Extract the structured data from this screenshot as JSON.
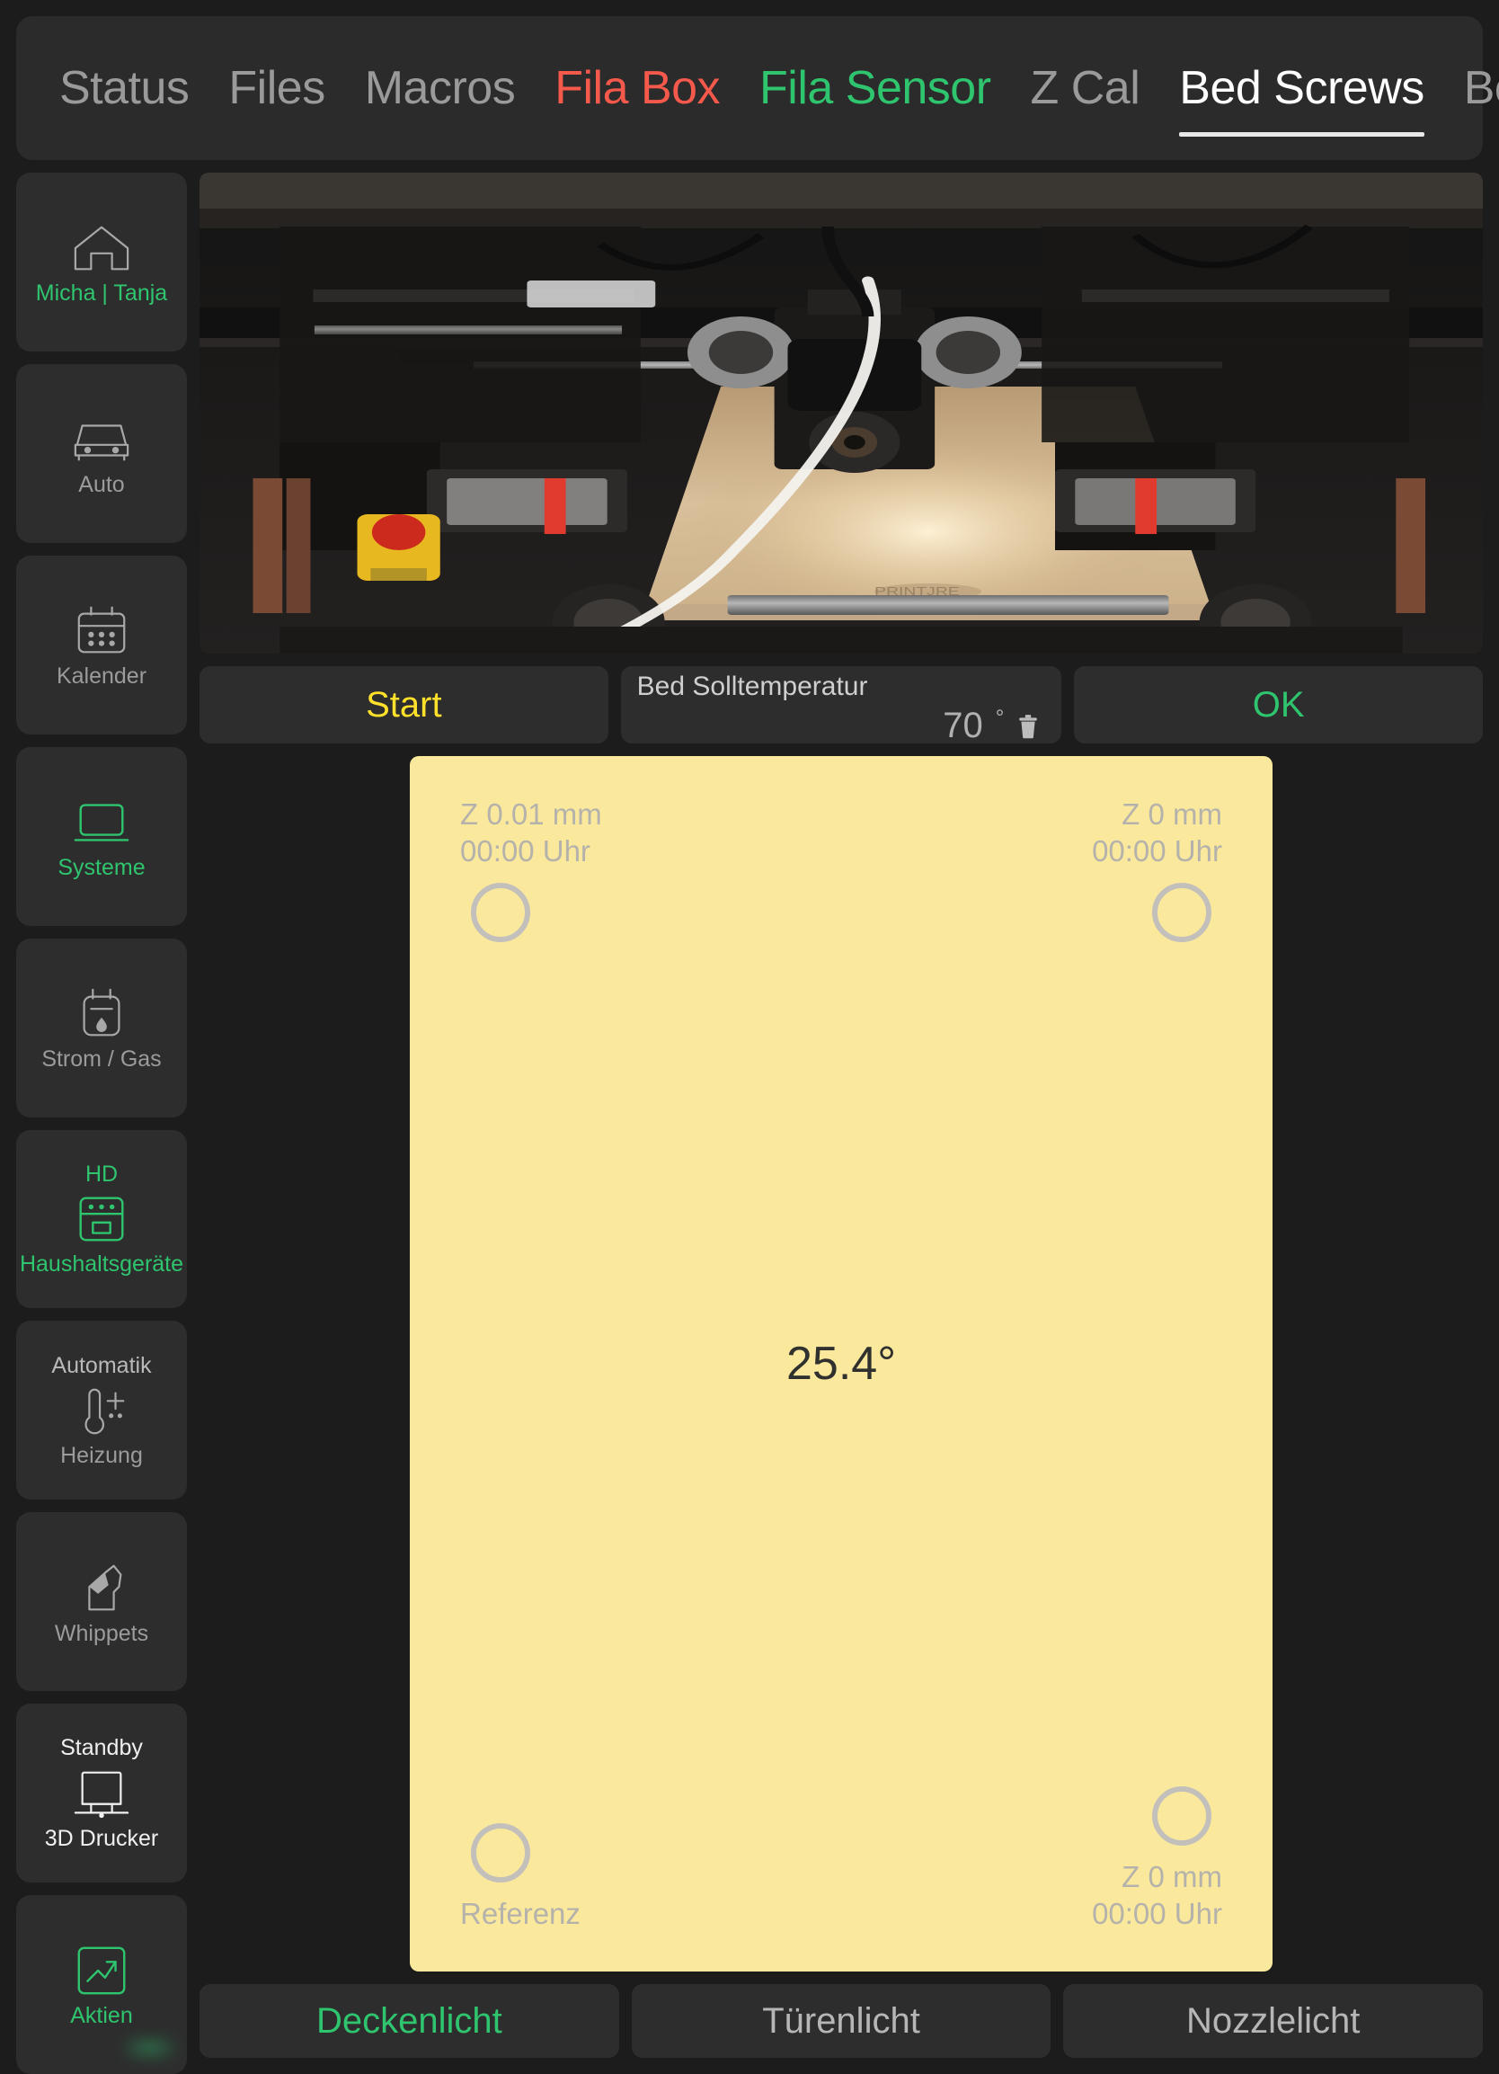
{
  "tabs": [
    {
      "label": "Status",
      "state": "normal"
    },
    {
      "label": "Files",
      "state": "normal"
    },
    {
      "label": "Macros",
      "state": "normal"
    },
    {
      "label": "Fila Box",
      "state": "red"
    },
    {
      "label": "Fila Sensor",
      "state": "green"
    },
    {
      "label": "Z Cal",
      "state": "normal"
    },
    {
      "label": "Bed Screws",
      "state": "active"
    },
    {
      "label": "Bed Mesh",
      "state": "normal"
    }
  ],
  "sidebar": {
    "items": [
      {
        "top": "",
        "label": "Micha | Tanja",
        "icon": "home-icon",
        "state": "green"
      },
      {
        "top": "",
        "label": "Auto",
        "icon": "car-icon",
        "state": "normal"
      },
      {
        "top": "",
        "label": "Kalender",
        "icon": "calendar-icon",
        "state": "normal"
      },
      {
        "top": "",
        "label": "Systeme",
        "icon": "laptop-icon",
        "state": "green"
      },
      {
        "top": "",
        "label": "Strom / Gas",
        "icon": "meter-icon",
        "state": "normal"
      },
      {
        "top": "HD",
        "label": "Haushaltsgeräte",
        "icon": "oven-icon",
        "state": "green"
      },
      {
        "top": "Automatik",
        "label": "Heizung",
        "icon": "thermostat-icon",
        "state": "normal"
      },
      {
        "top": "",
        "label": "Whippets",
        "icon": "dog-icon",
        "state": "normal"
      },
      {
        "top": "Standby",
        "label": "3D Drucker",
        "icon": "printer-icon",
        "state": "white"
      },
      {
        "top": "",
        "label": "Aktien",
        "icon": "trend-icon",
        "state": "green"
      }
    ]
  },
  "controls": {
    "start_label": "Start",
    "temp_label": "Bed Solltemperatur",
    "temp_value": "70",
    "temp_unit": "°",
    "delete_icon": "trash-icon",
    "ok_label": "OK"
  },
  "bed_screws": {
    "top_left": {
      "z": "Z 0.01 mm",
      "time": "00:00 Uhr"
    },
    "top_right": {
      "z": "Z 0 mm",
      "time": "00:00 Uhr"
    },
    "bottom_left": {
      "z": "Referenz",
      "time": ""
    },
    "bottom_right": {
      "z": "Z 0 mm",
      "time": "00:00 Uhr"
    },
    "temperature": "25.4°"
  },
  "lights": {
    "ceiling": "Deckenlicht",
    "door": "Türenlicht",
    "nozzle": "Nozzlelicht"
  },
  "colors": {
    "accent_green": "#2fc46e",
    "accent_red": "#f4594b",
    "accent_yellow": "#ffe02a",
    "pad_background": "#fae99c",
    "panel": "#2d2d2d",
    "page_background": "#1c1c1c"
  }
}
